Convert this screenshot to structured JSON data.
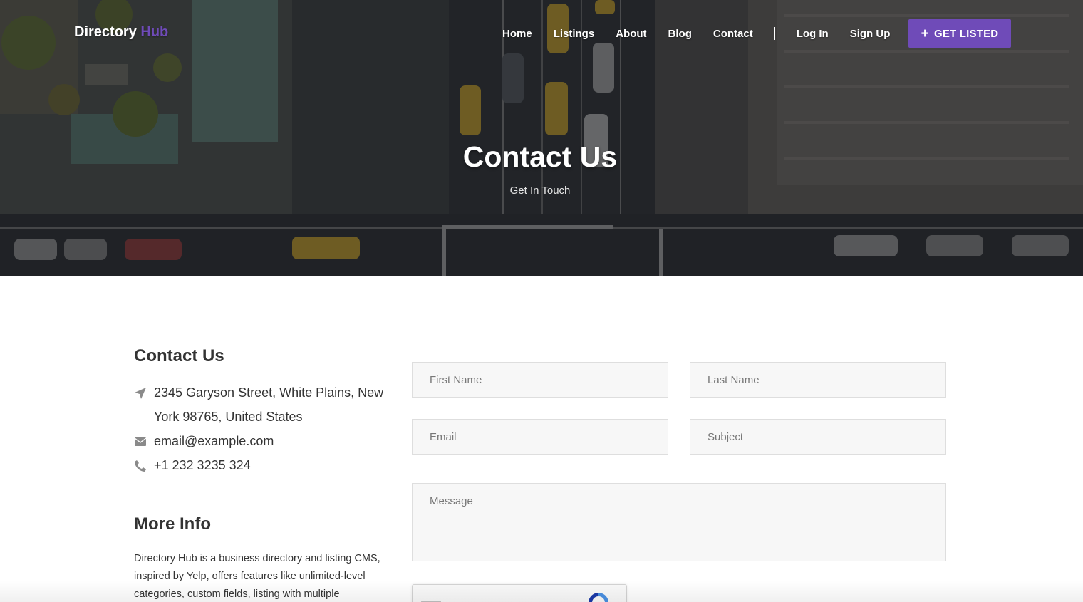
{
  "brand": {
    "name": "Directory",
    "accent": "Hub",
    "accent_color": "#6f4bb8"
  },
  "nav": {
    "links": [
      "Home",
      "Listings",
      "About",
      "Blog",
      "Contact"
    ],
    "auth": [
      "Log In",
      "Sign Up"
    ],
    "cta_label": "GET LISTED",
    "cta_icon": "plus-icon"
  },
  "hero": {
    "title": "Contact Us",
    "subtitle": "Get In Touch"
  },
  "contact": {
    "heading": "Contact Us",
    "address": "2345 Garyson Street, White Plains, New York 98765, United States",
    "email": "email@example.com",
    "phone": "+1 232 3235 324",
    "icons": [
      "location-arrow-icon",
      "envelope-icon",
      "phone-icon"
    ]
  },
  "more_info": {
    "heading": "More Info",
    "text": "Directory Hub is a business directory and listing CMS, inspired by Yelp, offers features like unlimited-level categories, custom fields, listing with multiple"
  },
  "form": {
    "first_name_placeholder": "First Name",
    "last_name_placeholder": "Last Name",
    "email_placeholder": "Email",
    "subject_placeholder": "Subject",
    "message_placeholder": "Message"
  },
  "colors": {
    "accent": "#6f4bb8",
    "field_bg": "#f7f7f7",
    "field_border": "#dedede"
  }
}
